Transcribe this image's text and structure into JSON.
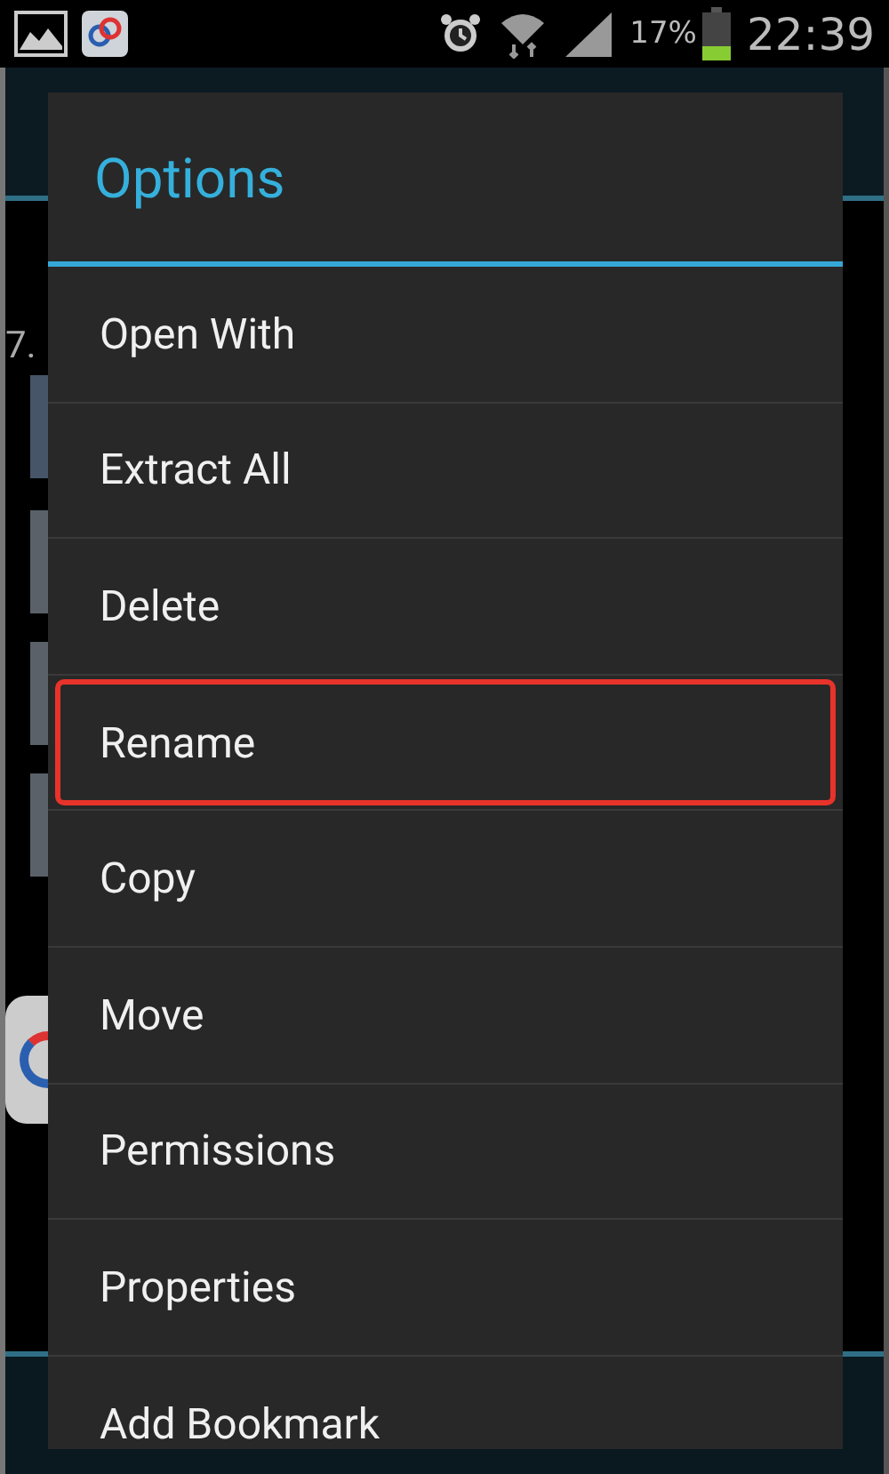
{
  "status_bar": {
    "battery_text": "17%",
    "time": "22:39"
  },
  "background": {
    "text": "7."
  },
  "dialog": {
    "title": "Options",
    "items": [
      {
        "label": "Open With",
        "selected": false
      },
      {
        "label": "Extract All",
        "selected": false
      },
      {
        "label": "Delete",
        "selected": false
      },
      {
        "label": "Rename",
        "selected": true
      },
      {
        "label": "Copy",
        "selected": false
      },
      {
        "label": "Move",
        "selected": false
      },
      {
        "label": "Permissions",
        "selected": false
      },
      {
        "label": "Properties",
        "selected": false
      },
      {
        "label": "Add Bookmark",
        "selected": false
      }
    ]
  }
}
